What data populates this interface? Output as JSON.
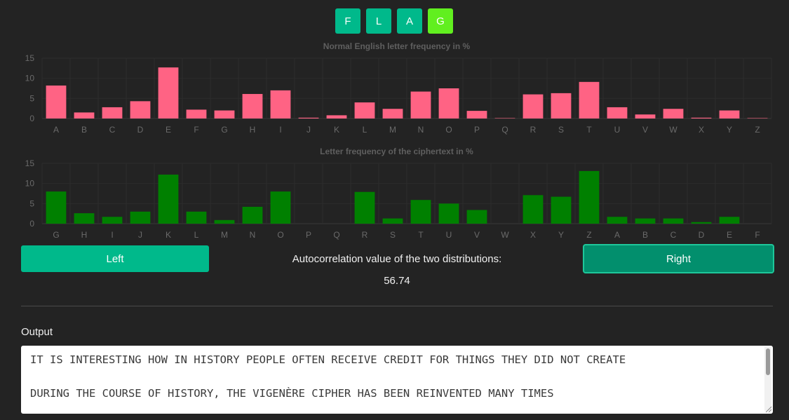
{
  "key_tiles": [
    {
      "letter": "F",
      "color": "#00b98b"
    },
    {
      "letter": "L",
      "color": "#00b98b"
    },
    {
      "letter": "A",
      "color": "#00b98b"
    },
    {
      "letter": "G",
      "color": "#61ef1f"
    }
  ],
  "chart_data": [
    {
      "type": "bar",
      "title": "Normal English letter frequency in %",
      "categories": [
        "A",
        "B",
        "C",
        "D",
        "E",
        "F",
        "G",
        "H",
        "I",
        "J",
        "K",
        "L",
        "M",
        "N",
        "O",
        "P",
        "Q",
        "R",
        "S",
        "T",
        "U",
        "V",
        "W",
        "X",
        "Y",
        "Z"
      ],
      "values": [
        8.2,
        1.5,
        2.8,
        4.3,
        12.7,
        2.2,
        2.0,
        6.1,
        7.0,
        0.2,
        0.8,
        4.0,
        2.4,
        6.7,
        7.5,
        1.9,
        0.1,
        6.0,
        6.3,
        9.1,
        2.8,
        1.0,
        2.4,
        0.2,
        2.0,
        0.1
      ],
      "ylim": [
        0,
        15
      ],
      "yticks": [
        0,
        5,
        10,
        15
      ],
      "color": "#ff6384",
      "grid": true
    },
    {
      "type": "bar",
      "title": "Letter frequency of the ciphertext in %",
      "categories": [
        "G",
        "H",
        "I",
        "J",
        "K",
        "L",
        "M",
        "N",
        "O",
        "P",
        "Q",
        "R",
        "S",
        "T",
        "U",
        "V",
        "W",
        "X",
        "Y",
        "Z",
        "A",
        "B",
        "C",
        "D",
        "E",
        "F"
      ],
      "values": [
        8.0,
        2.6,
        1.7,
        3.0,
        12.2,
        3.0,
        0.9,
        4.2,
        8.0,
        0,
        0,
        7.9,
        1.3,
        5.9,
        5.0,
        3.4,
        0,
        7.1,
        6.7,
        13.1,
        1.7,
        1.3,
        1.3,
        0.4,
        1.7,
        0
      ],
      "ylim": [
        0,
        15
      ],
      "yticks": [
        0,
        5,
        10,
        15
      ],
      "color": "#008000",
      "grid": true
    }
  ],
  "controls": {
    "left_label": "Left",
    "right_label": "Right",
    "autocorr_label": "Autocorrelation value of the two distributions:",
    "autocorr_value": "56.74"
  },
  "output": {
    "label": "Output",
    "text": "IT IS INTERESTING HOW IN HISTORY PEOPLE OFTEN RECEIVE CREDIT FOR THINGS THEY DID NOT CREATE\n\nDURING THE COURSE OF HISTORY, THE VIGENÈRE CIPHER HAS BEEN REINVENTED MANY TIMES"
  }
}
